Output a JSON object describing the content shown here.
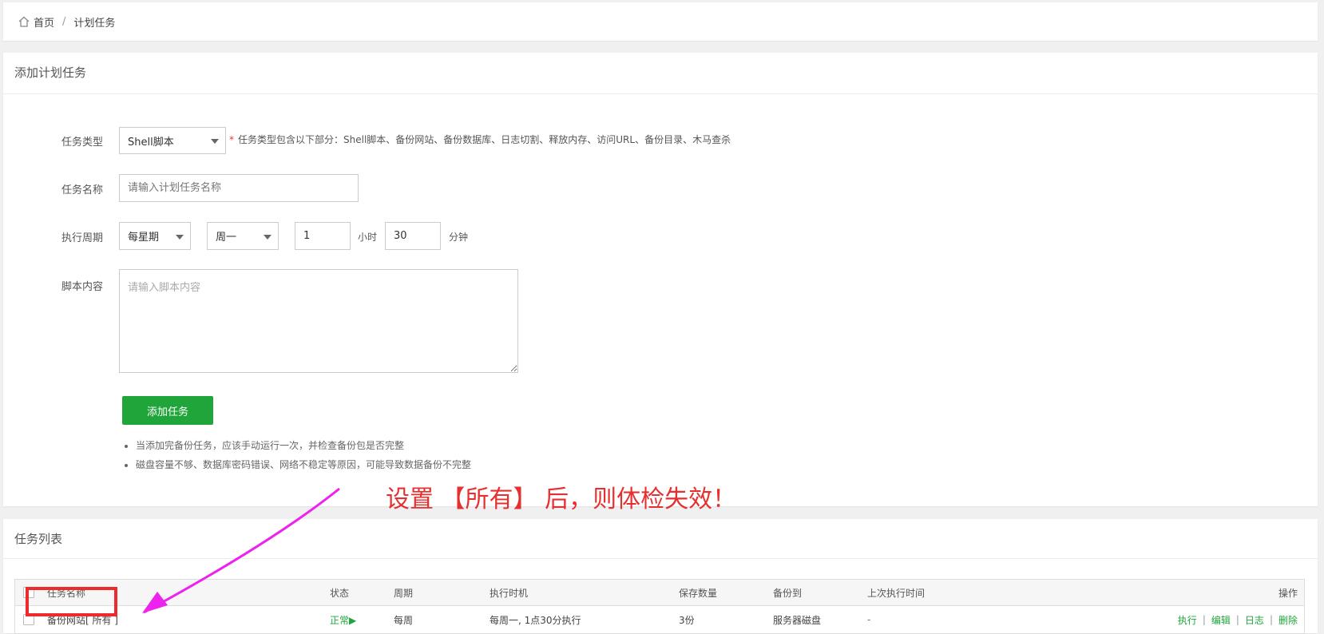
{
  "breadcrumb": {
    "home": "首页",
    "separator": "/",
    "current": "计划任务"
  },
  "form": {
    "title": "添加计划任务",
    "task_type": {
      "label": "任务类型",
      "value": "Shell脚本",
      "hint": "任务类型包含以下部分：Shell脚本、备份网站、备份数据库、日志切割、释放内存、访问URL、备份目录、木马查杀"
    },
    "task_name": {
      "label": "任务名称",
      "placeholder": "请输入计划任务名称"
    },
    "period": {
      "label": "执行周期",
      "cycle": "每星期",
      "weekday": "周一",
      "hour": "1",
      "hour_unit": "小时",
      "minute": "30",
      "minute_unit": "分钟"
    },
    "script": {
      "label": "脚本内容",
      "placeholder": "请输入脚本内容"
    },
    "submit_label": "添加任务",
    "tips": [
      "当添加完备份任务，应该手动运行一次，并检查备份包是否完整",
      "磁盘容量不够、数据库密码错误、网络不稳定等原因，可能导致数据备份不完整"
    ]
  },
  "annotation": "设置 【所有】 后，则体检失效！",
  "list": {
    "title": "任务列表",
    "columns": {
      "name": "任务名称",
      "status": "状态",
      "period": "周期",
      "time": "执行时机",
      "keep": "保存数量",
      "target": "备份到",
      "last": "上次执行时间",
      "ops": "操作"
    },
    "rows": [
      {
        "name": "备份网站[ 所有 ]",
        "status": "正常▶",
        "period": "每周",
        "time": "每周一, 1点30分执行",
        "keep": "3份",
        "target": "服务器磁盘",
        "last": "-",
        "ops": {
          "run": "执行",
          "edit": "编辑",
          "log": "日志",
          "delete": "删除",
          "sep": "|"
        }
      }
    ]
  },
  "colors": {
    "accent": "#20a53a",
    "annotation": "#e62f2f",
    "arrow": "#ee22ee"
  }
}
